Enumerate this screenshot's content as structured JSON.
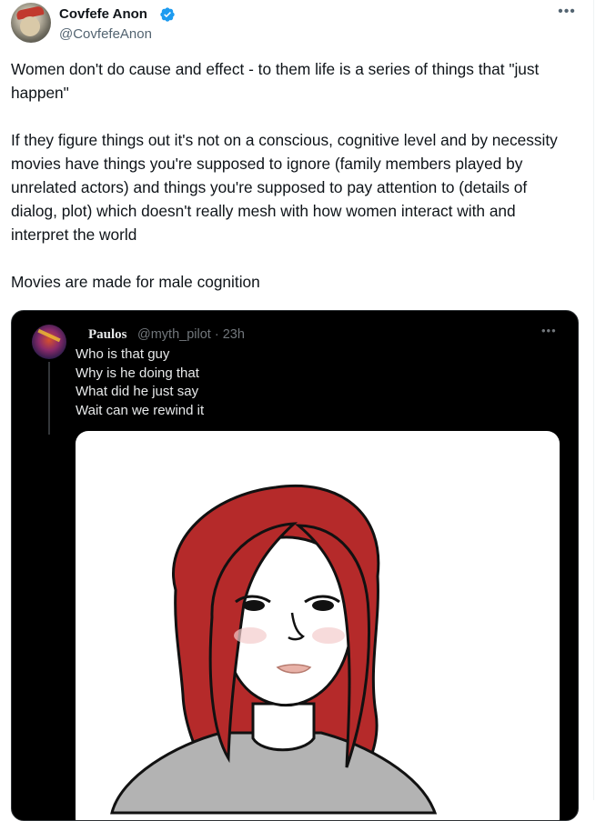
{
  "tweet": {
    "author": {
      "display_name": "Covfefe Anon",
      "handle": "@CovfefeAnon",
      "verified": true
    },
    "more_icon": "more-horizontal-icon",
    "text": [
      "Women don't do cause and effect - to them life is a series of things that \"just happen\"",
      "If they figure things out it's not on a conscious, cognitive level and by necessity movies have things you're supposed to ignore (family members played by unrelated actors) and things you're supposed to pay attention to (details of dialog, plot) which doesn't really mesh with how women interact with and interpret the world",
      "Movies are made for male cognition"
    ],
    "quoted_tweet": {
      "author": {
        "display_name": "Paulos",
        "handle": "@myth_pilot",
        "time": "· 23h"
      },
      "lines": [
        "Who is that guy",
        "Why is he doing that",
        "What did he just say",
        "Wait can we rewind it"
      ],
      "media": {
        "icon": "illustration-woman-red-hair",
        "colors": {
          "hair": "#b52a2a",
          "skin": "#ffffff",
          "shirt": "#b3b3b3"
        }
      }
    }
  },
  "colors": {
    "verified_blue": "#1d9bf0",
    "text_primary": "#0f1419",
    "text_secondary": "#536471",
    "quote_background": "#000000"
  }
}
